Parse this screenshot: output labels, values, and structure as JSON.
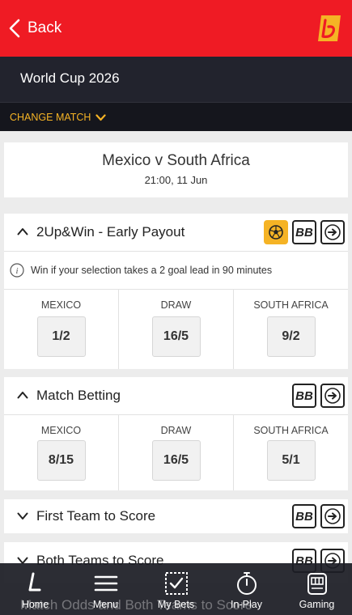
{
  "header": {
    "back_label": "Back"
  },
  "title": "World Cup 2026",
  "change_match": "CHANGE MATCH",
  "match": {
    "name": "Mexico v South Africa",
    "time": "21:00, 11 Jun"
  },
  "markets": [
    {
      "title": "2Up&Win - Early Payout",
      "info": "Win if your selection takes a 2 goal lead in 90 minutes",
      "selections": [
        {
          "label": "MEXICO",
          "odds": "1/2"
        },
        {
          "label": "DRAW",
          "odds": "16/5"
        },
        {
          "label": "SOUTH AFRICA",
          "odds": "9/2"
        }
      ]
    },
    {
      "title": "Match Betting",
      "selections": [
        {
          "label": "MEXICO",
          "odds": "8/15"
        },
        {
          "label": "DRAW",
          "odds": "16/5"
        },
        {
          "label": "SOUTH AFRICA",
          "odds": "5/1"
        }
      ]
    },
    {
      "title": "First Team to Score"
    },
    {
      "title": "Both Teams to Score"
    }
  ],
  "badge_bb": "BB",
  "hidden_market": "Match Odds and Both Teams to Score",
  "bottom_nav": [
    {
      "label": "Home",
      "icon": "home-icon"
    },
    {
      "label": "Menu",
      "icon": "menu-icon"
    },
    {
      "label": "My Bets",
      "icon": "my-bets-icon"
    },
    {
      "label": "In-Play",
      "icon": "stopwatch-icon"
    },
    {
      "label": "Gaming",
      "icon": "slot-machine-icon"
    }
  ],
  "colors": {
    "brand_red": "#ef1b24",
    "dark": "#22232d",
    "accent_yellow": "#f5b325"
  }
}
